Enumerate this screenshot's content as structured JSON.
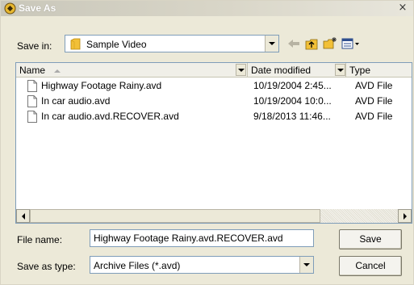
{
  "window": {
    "title": "Save As",
    "close_glyph": "×"
  },
  "save_in": {
    "label": "Save in:",
    "folder": "Sample Video",
    "folder_icon": "folder-icon",
    "toolbar_icons": [
      "back-arrow-icon",
      "up-folder-icon",
      "new-folder-icon",
      "view-menu-icon"
    ]
  },
  "list": {
    "columns": {
      "name": "Name",
      "date": "Date modified",
      "type": "Type"
    },
    "rows": [
      {
        "name": "Highway Footage Rainy.avd",
        "date": "10/19/2004 2:45...",
        "type": "AVD File"
      },
      {
        "name": "In car audio.avd",
        "date": "10/19/2004 10:0...",
        "type": "AVD File"
      },
      {
        "name": "In car audio.avd.RECOVER.avd",
        "date": "9/18/2013 11:46...",
        "type": "AVD File"
      }
    ]
  },
  "file_name": {
    "label": "File name:",
    "value": "Highway Footage Rainy.avd.RECOVER.avd"
  },
  "save_as_type": {
    "label": "Save as type:",
    "value": "Archive Files (*.avd)"
  },
  "buttons": {
    "save": "Save",
    "cancel": "Cancel"
  },
  "colors": {
    "dialog_bg": "#ece9d8",
    "field_border": "#7f9db9",
    "folder": "#f2c037"
  }
}
